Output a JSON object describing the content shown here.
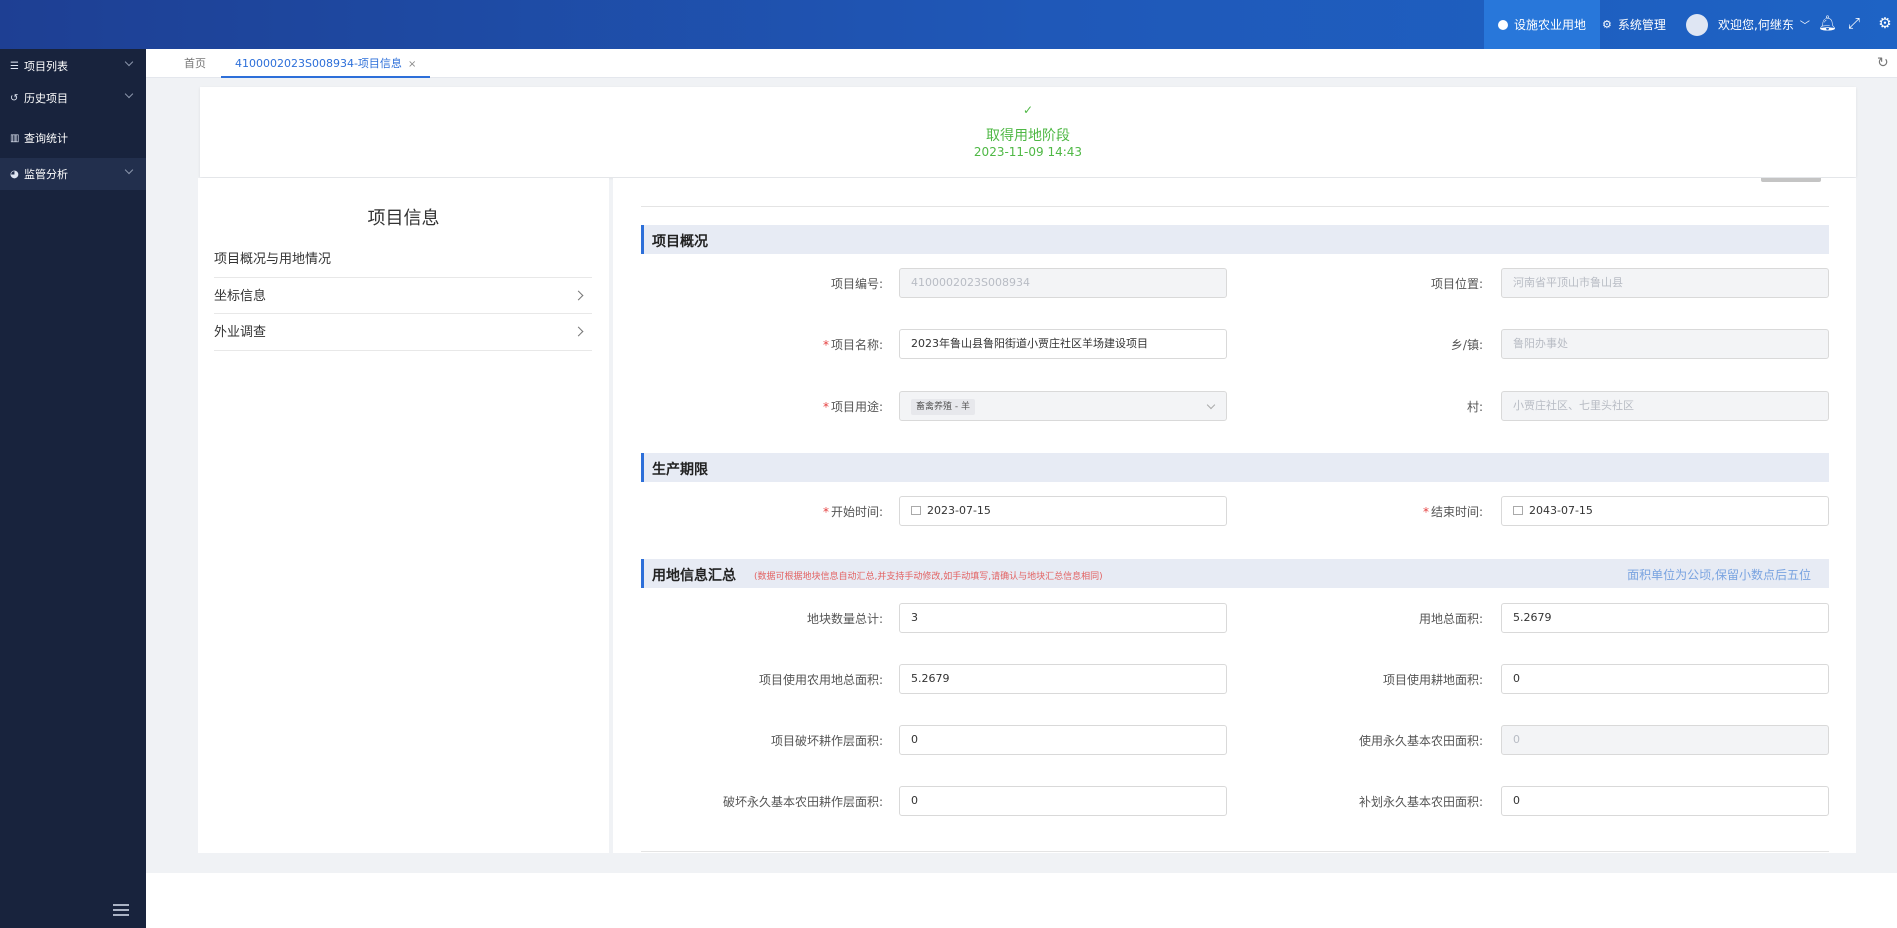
{
  "header": {
    "nav_facility_land": "设施农业用地",
    "nav_system_admin": "系统管理",
    "welcome": "欢迎您,何继东"
  },
  "sidebar": {
    "items": [
      {
        "label": "项目列表"
      },
      {
        "label": "历史项目"
      },
      {
        "label": "查询统计"
      },
      {
        "label": "监管分析"
      }
    ]
  },
  "tabs": {
    "home": "首页",
    "project": "4100002023S008934-项目信息",
    "close": "×"
  },
  "status": {
    "check": "✓",
    "stage": "取得用地阶段",
    "time": "2023-11-09 14:43"
  },
  "left_panel": {
    "title": "项目信息",
    "items": [
      {
        "label": "项目概况与用地情况"
      },
      {
        "label": "坐标信息"
      },
      {
        "label": "外业调查"
      }
    ]
  },
  "overview": {
    "section_title": "项目概况",
    "project_no_label": "项目编号:",
    "project_no": "4100002023S008934",
    "location_label": "项目位置:",
    "location": "河南省平顶山市鲁山县",
    "name_label": "项目名称:",
    "name": "2023年鲁山县鲁阳街道小贾庄社区羊场建设项目",
    "town_label": "乡/镇:",
    "town": "鲁阳办事处",
    "usage_label": "项目用途:",
    "usage": "畜禽养殖 - 羊",
    "village_label": "村:",
    "village": "小贾庄社区、七里头社区"
  },
  "production": {
    "section_title": "生产期限",
    "start_label": "开始时间:",
    "start": "2023-07-15",
    "end_label": "结束时间:",
    "end": "2043-07-15"
  },
  "land_summary": {
    "section_title": "用地信息汇总",
    "note": "(数据可根据地块信息自动汇总,并支持手动修改,如手动填写,请确认与地块汇总信息相同)",
    "unit_note": "面积单位为公顷,保留小数点后五位",
    "parcel_count_label": "地块数量总计:",
    "parcel_count": "3",
    "total_area_label": "用地总面积:",
    "total_area": "5.2679",
    "farmland_area_label": "项目使用农用地总面积:",
    "farmland_area": "5.2679",
    "cultivated_area_label": "项目使用耕地面积:",
    "cultivated_area": "0",
    "damaged_layer_label": "项目破坏耕作层面积:",
    "damaged_layer": "0",
    "permanent_basic_label": "使用永久基本农田面积:",
    "permanent_basic": "0",
    "damaged_permanent_label": "破坏永久基本农田耕作层面积:",
    "damaged_permanent": "0",
    "supplement_permanent_label": "补划永久基本农田面积:",
    "supplement_permanent": "0"
  }
}
